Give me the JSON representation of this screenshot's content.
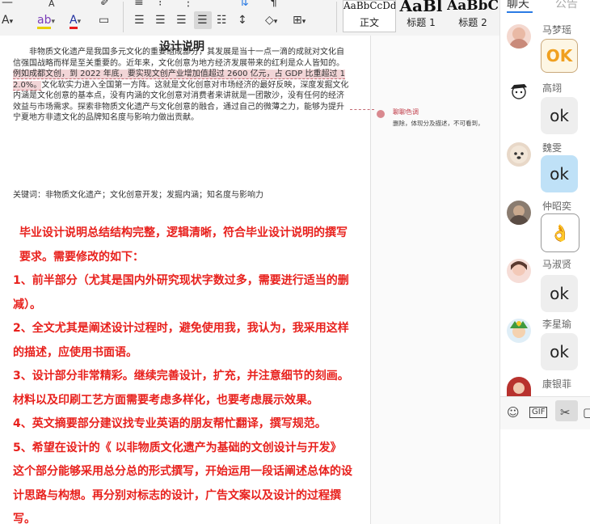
{
  "ribbon": {
    "row1": [
      "A",
      "✐"
    ],
    "font_controls": [
      "A",
      "ab",
      "A"
    ],
    "styles": [
      {
        "preview": "AaBbCcDd",
        "name": "正文"
      },
      {
        "preview": "AaBl",
        "name": "标题 1"
      },
      {
        "preview": "AaBbC",
        "name": "标题 2"
      }
    ]
  },
  "document": {
    "title": "设计说明",
    "body_before": "非物质文化遗产是我国多元文化的重要组成部分，其发展是当十一点一滴的成就对文化自信强国战略而样是至关重要的。近年来，文化创意为地方经济发展带来的红利是众人皆知的。",
    "body_highlight": "例如成都文创，到 2022 年底，要实现文创产业增加值超过 2600 亿元，占 GDP 比重超过 12.0%。",
    "body_after": "文化软实力进入全国第一方阵。这就是文化创意对市场经济的最好反映，深度发掘文化内涵是文化创意的基本点，没有内涵的文化创意对消费者来讲就是一团散沙，没有任何的经济效益与市场需求。探索非物质文化遗产与文化创意的融合，通过自己的微薄之力，能够为提升宁夏地方非遗文化的品牌知名度与影响力做出贡献。",
    "keywords": "关键词：非物质文化遗产；文化创意开发；发掘内涵；知名度与影响力",
    "feedback": [
      "毕业设计说明总结结构完整，逻辑清晰，符合毕业设计说明的撰写要求。需要修改的如下：",
      "1、前半部分（尤其是国内外研究现状字数过多，需要进行适当的删减）。",
      "2、全文尤其是阐述设计过程时，避免使用我，我认为，我采用这样的描述，应使用书面语。",
      "3、设计部分非常精彩。继续完善设计，扩充，并注意细节的刻画。材料以及印刷工艺方面需要考虑多样化，也要考虑展示效果。",
      "4、英文摘要部分建议找专业英语的朋友帮忙翻译，撰写规范。",
      "5、希望在设计的《 以非物质文化遗产为基础的文创设计与开发》这个部分能够采用总分总的形式撰写，开始运用一段话阐述总体的设计思路与构想。再分别对标志的设计，广告文案以及设计的过程撰写。"
    ],
    "comment": {
      "author": "聊聊色调",
      "text": "删除，体现分及描述，不可看到，"
    }
  },
  "chat": {
    "tabs": [
      "聊天",
      "公告"
    ],
    "messages": [
      {
        "name": "马梦瑶",
        "content": "OK"
      },
      {
        "name": "高翊",
        "content": "ok"
      },
      {
        "name": "魏雯",
        "content": "ok"
      },
      {
        "name": "仲昭奕",
        "content": "👌"
      },
      {
        "name": "马淑贤",
        "content": "ok"
      },
      {
        "name": "李星瑜",
        "content": "ok"
      },
      {
        "name": "康银菲",
        "content": ""
      }
    ],
    "toolbar": {
      "emoji": "☺",
      "gif": "GIF",
      "scissors": "✂",
      "more": "▢"
    }
  },
  "colors": {
    "feedback_red": "#e8211d",
    "accent_blue": "#2a7be4",
    "highlight": "#f2d5d7"
  }
}
